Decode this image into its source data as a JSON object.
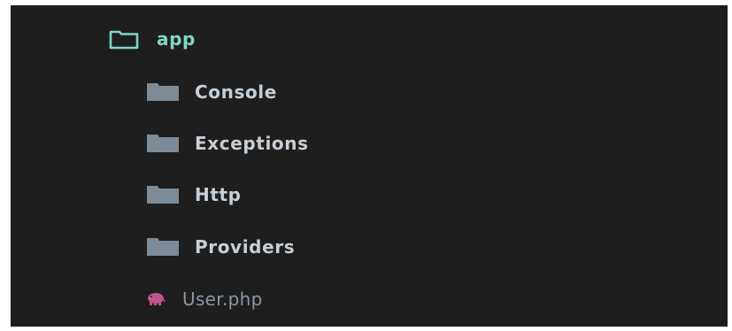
{
  "tree": {
    "root": {
      "label": "app",
      "icon": "folder-open-icon",
      "color": "#7fd6c6"
    },
    "folders": [
      {
        "label": "Console",
        "icon": "folder-icon"
      },
      {
        "label": "Exceptions",
        "icon": "folder-icon"
      },
      {
        "label": "Http",
        "icon": "folder-icon"
      },
      {
        "label": "Providers",
        "icon": "folder-icon"
      }
    ],
    "files": [
      {
        "label": "User.php",
        "icon": "php-file-icon",
        "color": "#c2558f"
      }
    ]
  },
  "colors": {
    "background": "#1e1e1e",
    "folder": "#7d8b96",
    "text": "#c7cfd6",
    "file_text": "#8a96a3"
  }
}
